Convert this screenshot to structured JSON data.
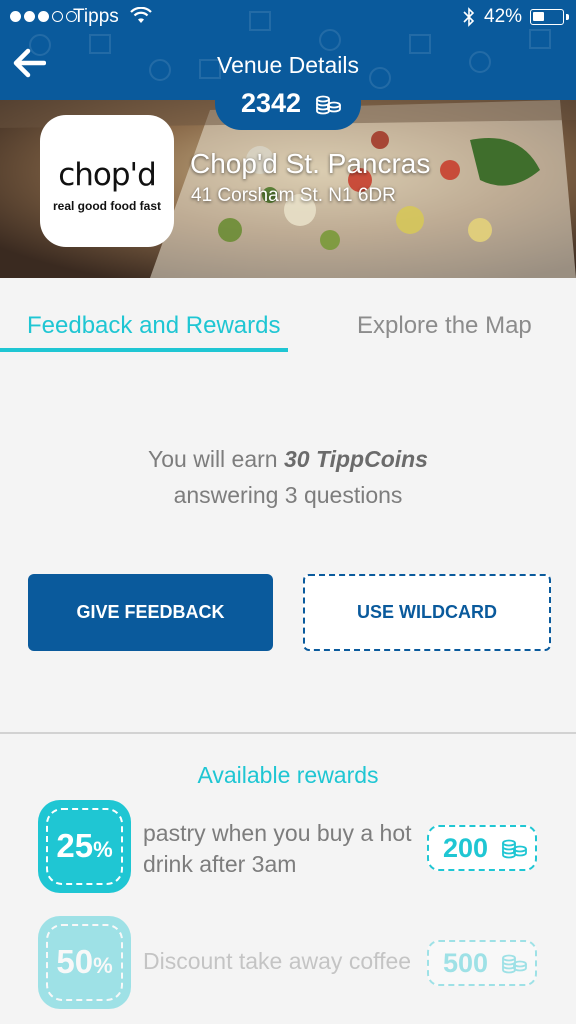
{
  "status_bar": {
    "carrier": "Tipps",
    "battery_pct": "42%",
    "battery_level": 0.42
  },
  "header": {
    "title": "Venue Details",
    "coin_balance": "2342"
  },
  "venue": {
    "logo_text": "chop'd",
    "logo_tagline": "real good food fast",
    "name": "Chop'd St. Pancras",
    "address": "41 Corsham St. N1 6DR"
  },
  "tabs": [
    {
      "label": "Feedback and Rewards",
      "active": true
    },
    {
      "label": "Explore the Map",
      "active": false
    }
  ],
  "earn": {
    "prefix": "You will earn",
    "amount": "30 TippCoins",
    "line2": "answering 3 questions"
  },
  "actions": {
    "feedback_label": "GIVE FEEDBACK",
    "wildcard_label": "USE WILDCARD"
  },
  "rewards": {
    "title": "Available rewards",
    "items": [
      {
        "percent": "25",
        "percent_sign": "%",
        "description": "pastry when you buy a hot drink after 3am",
        "cost": "200",
        "locked": false
      },
      {
        "percent": "50",
        "percent_sign": "%",
        "description": "Discount take away coffee",
        "cost": "500",
        "locked": true
      }
    ]
  },
  "colors": {
    "brand_blue": "#0a5a9c",
    "accent_teal": "#1fc6d3",
    "text_gray": "#7d7d7d"
  },
  "icons": [
    "back-arrow-icon",
    "wifi-icon",
    "bluetooth-icon",
    "battery-icon",
    "coins-icon"
  ]
}
